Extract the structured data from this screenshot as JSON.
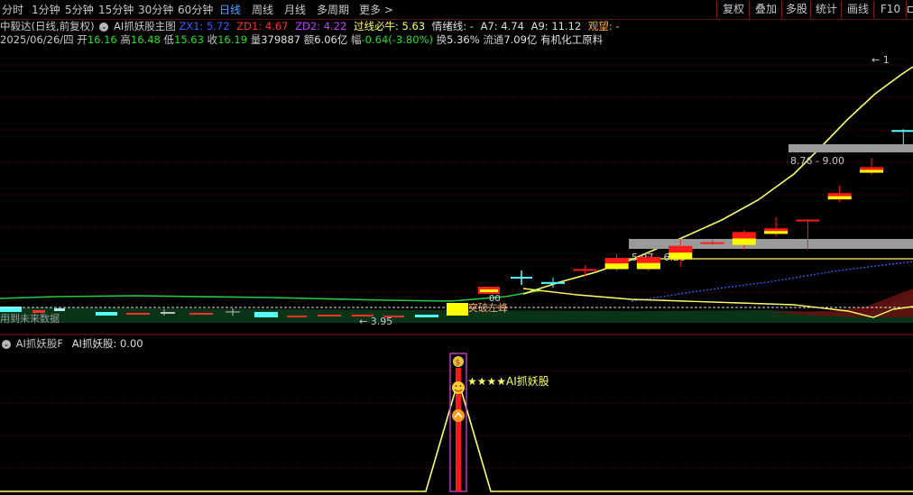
{
  "toolbar": {
    "periods": [
      "分时",
      "1分钟",
      "5分钟",
      "15分钟",
      "30分钟",
      "60分钟",
      "日线",
      "周线",
      "月线",
      "多周期",
      "更多"
    ],
    "active_period": "日线",
    "more_chevron": ">",
    "buttons": [
      "复权",
      "叠加",
      "多股",
      "统计",
      "画线",
      "F10"
    ],
    "square_icon": "square-icon"
  },
  "info_line1": {
    "stock": "中毅达(日线,前复权)",
    "indicator_name": "AI抓妖股主图",
    "zx_label": "ZX1:",
    "zx_value": "5.72",
    "zd1_label": "ZD1:",
    "zd1_value": "4.67",
    "zd2_label": "ZD2:",
    "zd2_value": "4.22",
    "guoxian_label": "过线必牛:",
    "guoxian_value": "5.63",
    "qingxu_label": "情绪线:",
    "qingxu_value": "-",
    "a7_label": "A7:",
    "a7_value": "4.74",
    "a9_label": "A9:",
    "a9_value": "11.12",
    "guanwang_label": "观望:",
    "guanwang_value": "-"
  },
  "info_line2": {
    "date": "2025/06/26/四",
    "open_label": "开",
    "open": "16.16",
    "high_label": "高",
    "high": "16.48",
    "low_label": "低",
    "low": "15.63",
    "close_label": "收",
    "close": "16.19",
    "vol_label": "量",
    "vol": "379887",
    "amount_label": "额",
    "amount": "6.06亿",
    "change_label": "幅",
    "change": "-0.64(-3.80%)",
    "turnover_label": "换",
    "turnover": "5.36%",
    "float_label": "流通",
    "float_cap": "7.09亿",
    "industry": "有机化工原料"
  },
  "chart_data": {
    "type": "candlestick",
    "price_range": [
      3.5,
      18.0
    ],
    "min_marker": "3.95",
    "max_marker_partial": "1",
    "zone_labels": [
      "8.76 - 9.00",
      "5.97 - 6.28"
    ],
    "breakout_label": "突破左峰",
    "left_note": "用到未来数据",
    "small_label": "00",
    "candles_major": [
      {
        "open": 5.7,
        "high": 5.95,
        "low": 5.4,
        "close": 5.6
      },
      {
        "open": 6.3,
        "high": 6.6,
        "low": 6.0,
        "close": 6.4
      },
      {
        "open": 6.4,
        "high": 7.2,
        "low": 6.3,
        "close": 7.0
      },
      {
        "open": 6.4,
        "high": 7.15,
        "low": 6.3,
        "close": 7.05
      },
      {
        "open": 6.92,
        "high": 8.0,
        "low": 6.5,
        "close": 7.65
      },
      {
        "open": 7.8,
        "high": 7.95,
        "low": 7.7,
        "close": 7.85
      },
      {
        "open": 7.7,
        "high": 8.5,
        "low": 7.45,
        "close": 8.4
      },
      {
        "open": 8.3,
        "high": 9.2,
        "low": 8.15,
        "close": 8.6
      },
      {
        "open": 9.07,
        "high": 9.1,
        "low": 7.45,
        "close": 9.07
      },
      {
        "open": 10.16,
        "high": 10.9,
        "low": 10.0,
        "close": 10.5
      },
      {
        "open": 11.6,
        "high": 12.4,
        "low": 11.5,
        "close": 11.9
      },
      {
        "open": 13.9,
        "high": 13.95,
        "low": 13.1,
        "close": 13.85
      },
      {
        "open": 16.16,
        "high": 16.48,
        "low": 15.63,
        "close": 16.19
      },
      {
        "open": 16.6,
        "high": 16.8,
        "low": 14.5,
        "close": 14.7
      }
    ]
  },
  "indicator": {
    "name": "AI抓妖股F",
    "value_label": "AI抓妖股:",
    "value": "0.00",
    "signal_label": "★★★★AI抓妖股"
  },
  "colors": {
    "up": "#ff1a1a",
    "fill_yellow": "#ffff00",
    "down": "#54ffff",
    "ma_yellow": "#ffff66",
    "ma_green": "#22cc44",
    "ma_blue": "#3a5cff",
    "zone_gray": "#9a9a9a",
    "indicator_purple": "#c040c0"
  }
}
